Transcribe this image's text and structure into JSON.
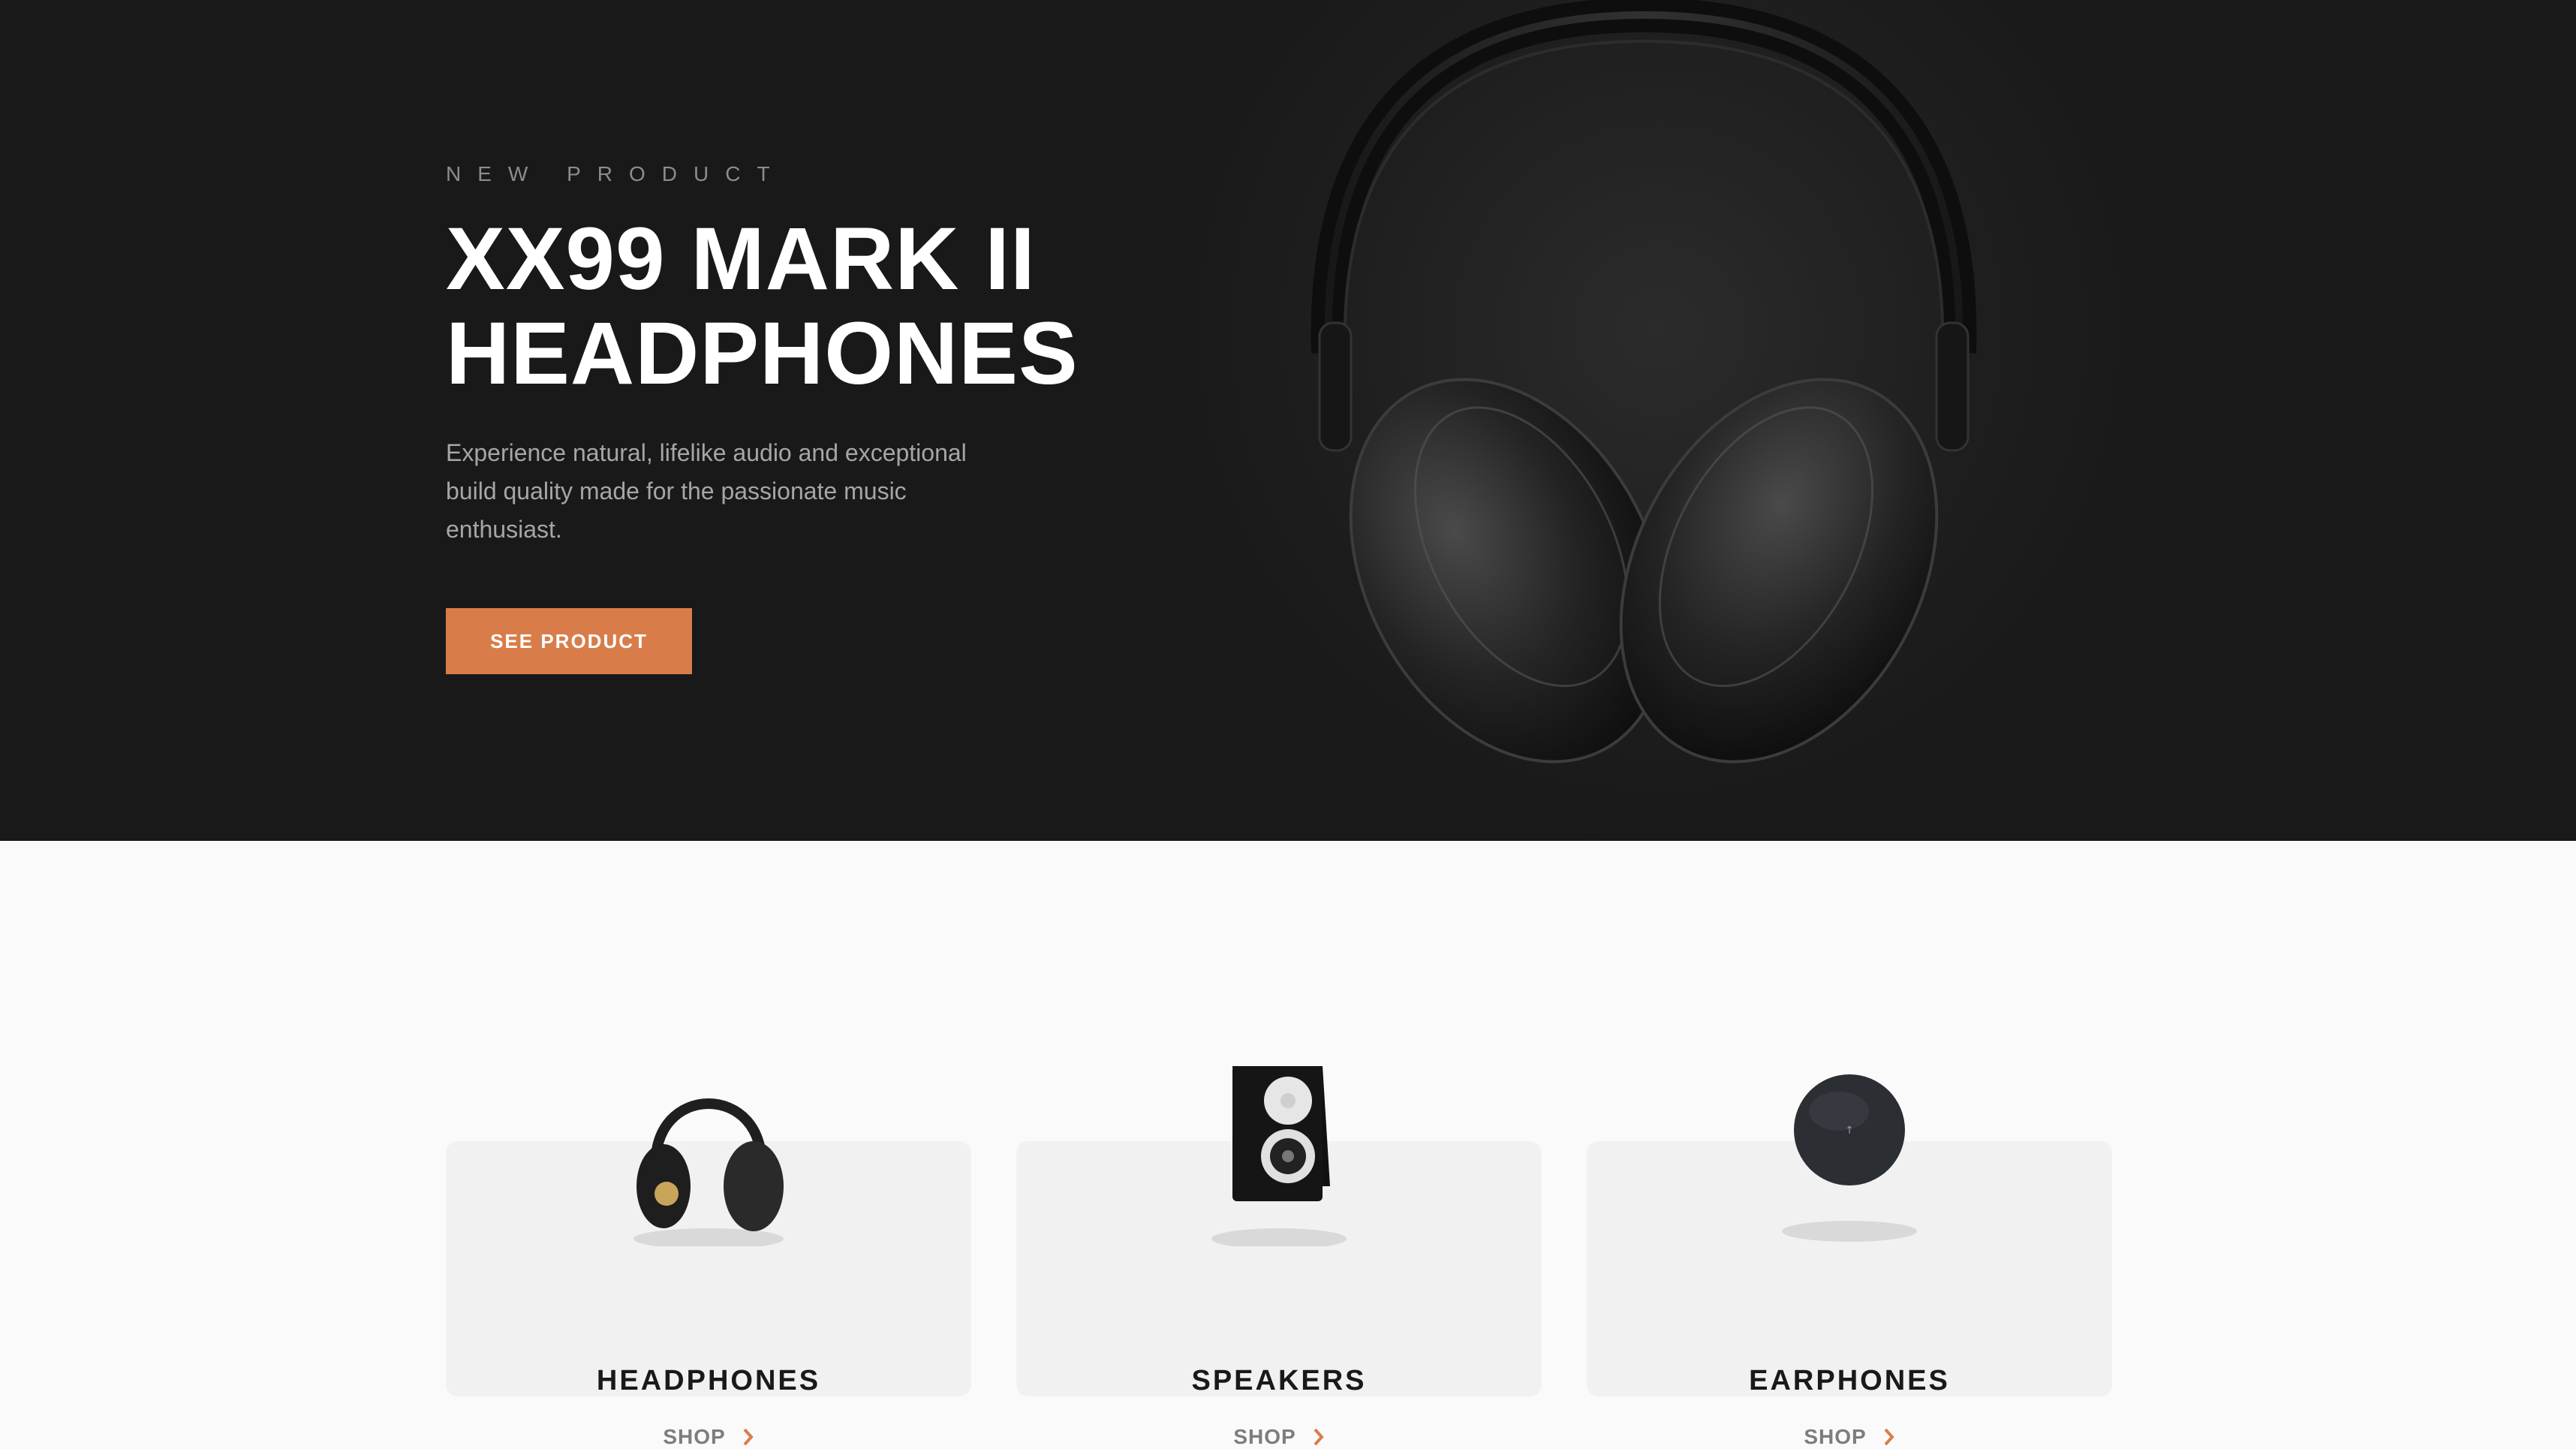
{
  "hero": {
    "overline": "NEW PRODUCT",
    "title_line1": "XX99 MARK II",
    "title_line2": "HEADPHONES",
    "description": "Experience natural, lifelike audio and exceptional build quality made for the passionate music enthusiast.",
    "cta_label": "SEE PRODUCT",
    "image_icon": "headphones-hero-image"
  },
  "categories": [
    {
      "title": "HEADPHONES",
      "link": "SHOP",
      "icon": "headphones-icon"
    },
    {
      "title": "SPEAKERS",
      "link": "SHOP",
      "icon": "speaker-icon"
    },
    {
      "title": "EARPHONES",
      "link": "SHOP",
      "icon": "earphones-case-icon"
    }
  ],
  "colors": {
    "hero_background": "#191919",
    "accent": "#d87d4a",
    "page_background": "#fafafa",
    "card_background": "#f1f1f1"
  }
}
